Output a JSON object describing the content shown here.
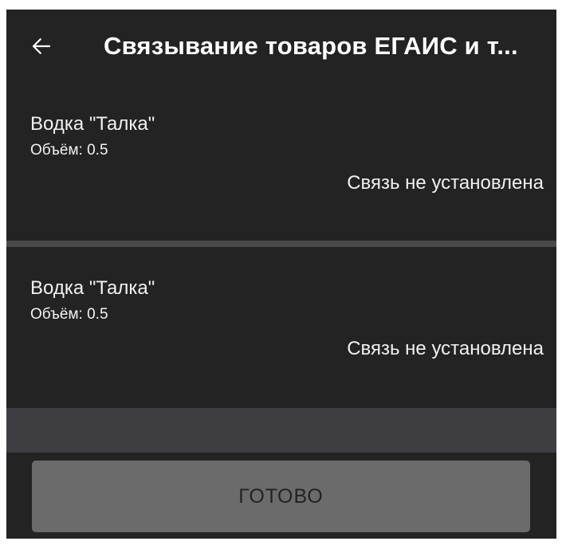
{
  "appbar": {
    "back_icon": "arrow-left-icon",
    "title": "Связывание товаров ЕГАИС и т..."
  },
  "items": [
    {
      "name": "Водка \"Талка\"",
      "volume": "Объём: 0.5",
      "status": "Связь не установлена"
    },
    {
      "name": "Водка \"Талка\"",
      "volume": "Объём: 0.5",
      "status": "Связь не установлена"
    }
  ],
  "footer": {
    "done_label": "ГОТОВО"
  },
  "colors": {
    "background": "#232323",
    "divider": "#4a4a4a",
    "button": "#6b6b6b",
    "bar": "#3d3d42"
  }
}
